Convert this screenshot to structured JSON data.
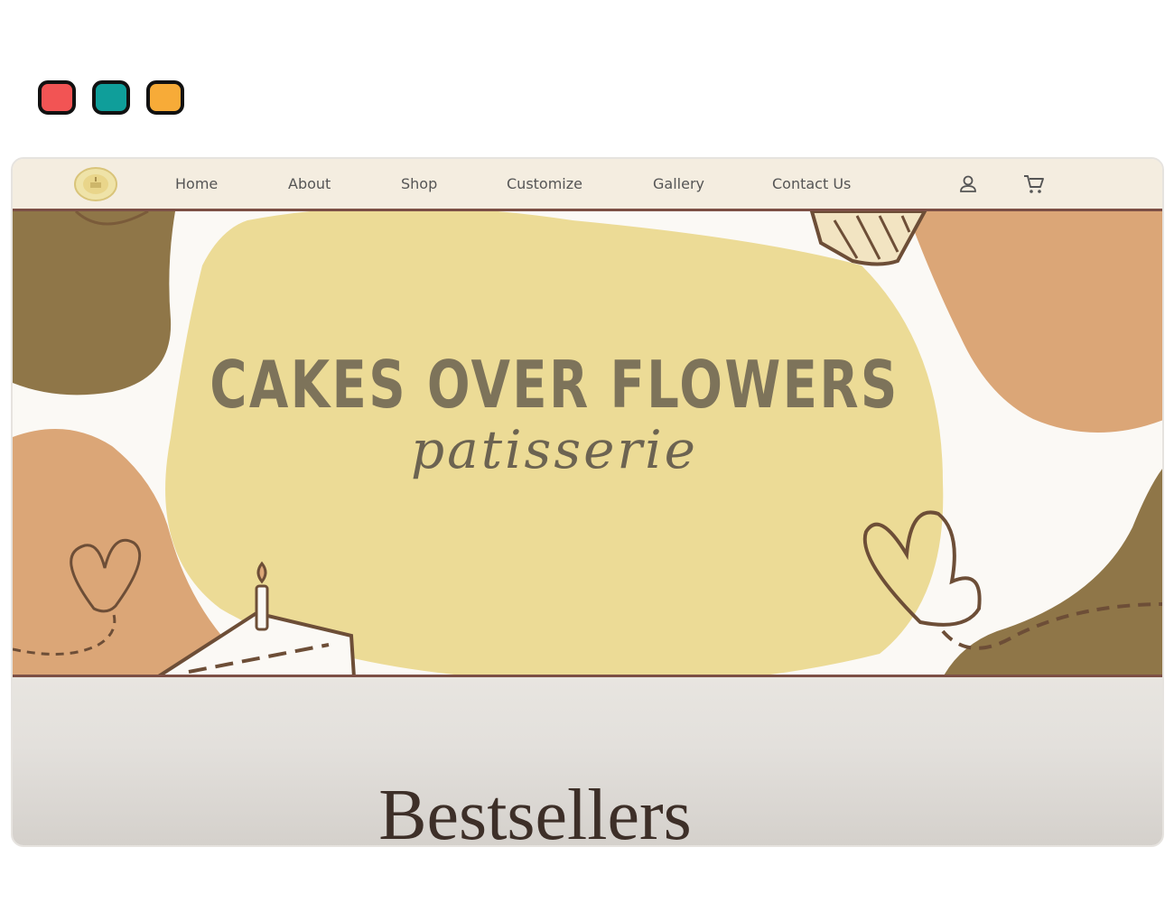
{
  "window_controls": [
    {
      "name": "close",
      "color": "#f25454"
    },
    {
      "name": "minimize",
      "color": "#0f9e9a"
    },
    {
      "name": "maximize",
      "color": "#f7ab38"
    }
  ],
  "nav": {
    "logo_icon": "cake-logo-icon",
    "links": [
      "Home",
      "About",
      "Shop",
      "Customize",
      "Gallery",
      "Contact Us"
    ],
    "account_icon": "user-icon",
    "cart_icon": "cart-icon"
  },
  "hero": {
    "title": "CAKES OVER FLOWERS",
    "subtitle": "patisserie"
  },
  "section": {
    "heading": "Bestsellers"
  },
  "colors": {
    "nav_bg": "#f4ede0",
    "accent_border": "#7c4f45",
    "blob_yellow": "#ecdb96",
    "blob_olive": "#8f7648",
    "blob_tan": "#dba677"
  }
}
